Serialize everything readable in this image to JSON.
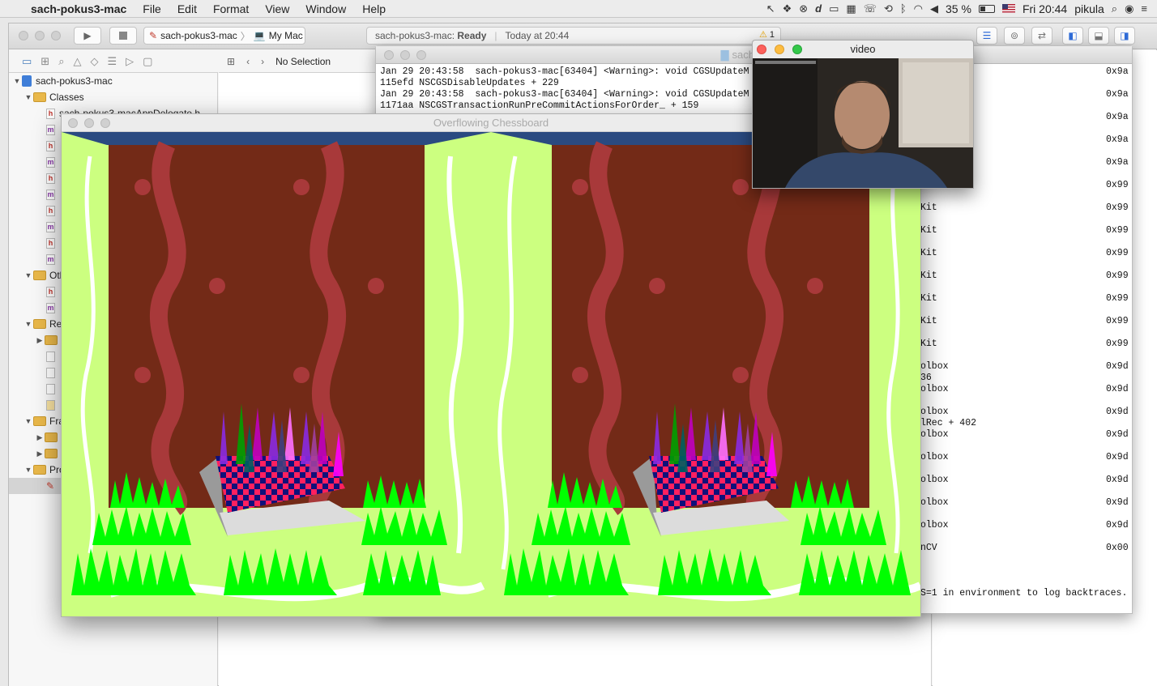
{
  "menubar": {
    "app": "sach-pokus3-mac",
    "items": [
      "File",
      "Edit",
      "Format",
      "View",
      "Window",
      "Help"
    ],
    "battery": "35 %",
    "clock": "Fri 20:44",
    "user": "pikula"
  },
  "xcode": {
    "scheme": "sach-pokus3-mac",
    "destination": "My Mac",
    "status_project": "sach-pokus3-mac:",
    "status_state": "Ready",
    "status_time": "Today at 20:44",
    "warning_count": "1",
    "jumpbar": "No Selection",
    "navigator": {
      "project": "sach-pokus3-mac",
      "classes_group": "Classes",
      "first_file": "sach-pokus3-macAppDelegate.h",
      "group_other": "Oth",
      "group_resources": "Res",
      "group_frameworks": "Fra",
      "group_products": "Pro"
    }
  },
  "console": {
    "title": "sach-stereo",
    "lines": [
      "Jan 29 20:43:58  sach-pokus3-mac[63404] <Warning>: void CGSUpdateM",
      "115efd NSCGSDisableUpdates + 229",
      "Jan 29 20:43:58  sach-pokus3-mac[63404] <Warning>: void CGSUpdateM",
      "1171aa NSCGSTransactionRunPreCommitActionsForOrder_ + 159"
    ],
    "right_rows": [
      {
        "text": "",
        "addr": "0x9a"
      },
      {
        "text": "",
        "addr": "0x9a"
      },
      {
        "text": "",
        "addr": "0x9a"
      },
      {
        "text": "",
        "addr": "0x9a"
      },
      {
        "text": "",
        "addr": "0x9a"
      },
      {
        "text": "",
        "addr": "0x99"
      },
      {
        "text": "Kit",
        "addr": "0x99"
      },
      {
        "text": "Kit",
        "addr": "0x99"
      },
      {
        "text": "Kit",
        "addr": "0x99"
      },
      {
        "text": "Kit",
        "addr": "0x99"
      },
      {
        "text": "Kit",
        "addr": "0x99"
      },
      {
        "text": "Kit",
        "addr": "0x99"
      },
      {
        "text": "Kit",
        "addr": "0x99"
      },
      {
        "text": "olbox",
        "addr": "0x9d"
      },
      {
        "text": "olbox",
        "addr": "0x9d"
      },
      {
        "text": "olbox",
        "addr": "0x9d"
      },
      {
        "text": "olbox",
        "addr": "0x9d"
      },
      {
        "text": "olbox",
        "addr": "0x9d"
      },
      {
        "text": "olbox",
        "addr": "0x9d"
      },
      {
        "text": "olbox",
        "addr": "0x9d"
      },
      {
        "text": "olbox",
        "addr": "0x9d"
      },
      {
        "text": "nCV",
        "addr": "0x00"
      }
    ],
    "extra_36": " 36",
    "extra_402": "lRec + 402",
    "footer": "S=1 in environment to log backtraces."
  },
  "chess_window": {
    "title": "Overflowing Chessboard"
  },
  "video_window": {
    "title": "video"
  },
  "colors": {
    "lime": "#ccff80",
    "brown": "#732a17",
    "grass": "#00ff00",
    "title_blue": "#2a4a80"
  }
}
